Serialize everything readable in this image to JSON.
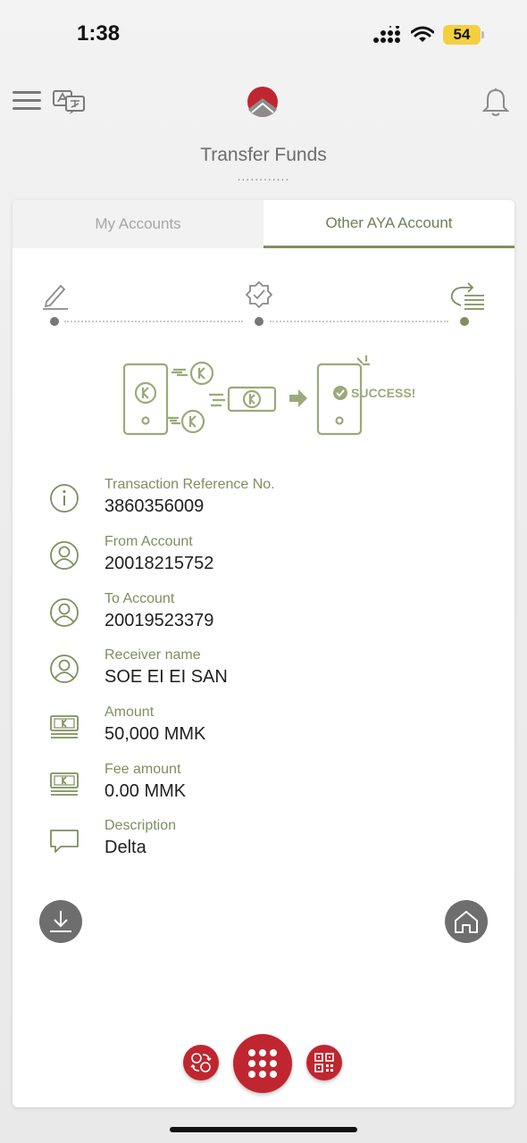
{
  "status_bar": {
    "time": "1:38",
    "battery": "54"
  },
  "header": {
    "title": "Transfer Funds",
    "dots": "............"
  },
  "tabs": [
    {
      "label": "My Accounts",
      "active": false
    },
    {
      "label": "Other AYA Account",
      "active": true
    }
  ],
  "stepper": {
    "current_step": 3,
    "total_steps": 3
  },
  "illustration": {
    "success_text": "SUCCESS!"
  },
  "details": [
    {
      "label": "Transaction Reference No.",
      "value": "3860356009",
      "icon": "info-icon"
    },
    {
      "label": "From Account",
      "value": "20018215752",
      "icon": "user-icon"
    },
    {
      "label": "To Account",
      "value": "20019523379",
      "icon": "user-icon"
    },
    {
      "label": "Receiver name",
      "value": "SOE EI EI SAN",
      "icon": "user-icon"
    },
    {
      "label": "Amount",
      "value": "50,000 MMK",
      "icon": "money-icon"
    },
    {
      "label": "Fee amount",
      "value": "0.00 MMK",
      "icon": "money-icon"
    },
    {
      "label": "Description",
      "value": "Delta",
      "icon": "comment-icon"
    }
  ],
  "colors": {
    "accent": "#7e8f5e",
    "brand_red": "#c0262f",
    "grey_button": "#6e6e6e"
  }
}
